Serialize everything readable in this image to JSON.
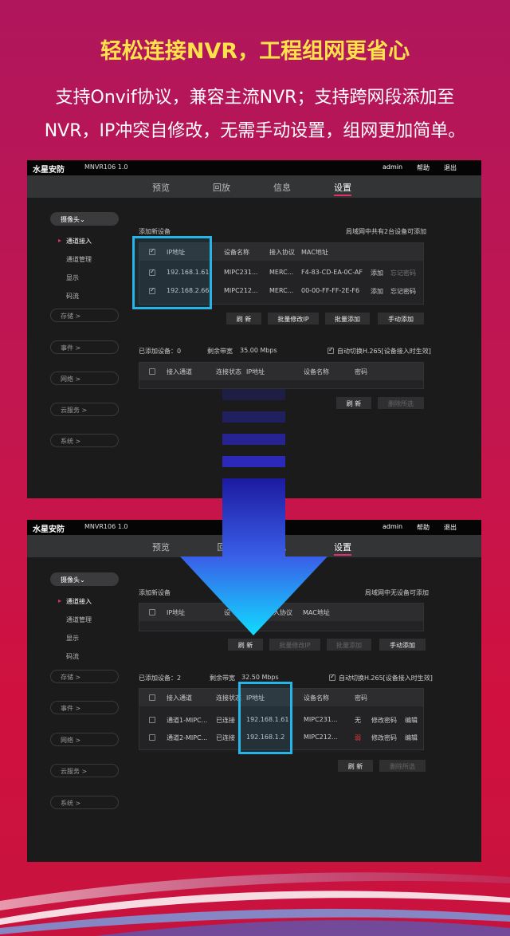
{
  "banner": {
    "headline": "轻松连接NVR，工程组网更省心",
    "line1": "支持Onvif协议，兼容主流NVR；支持跨网段添加至",
    "line2": "NVR，IP冲突自修改，无需手动设置，组网更加简单。"
  },
  "colors": {
    "accent": "#e0306a",
    "highlight": "#27b5e8",
    "headline": "#ffe24a",
    "arrow": "#0fd8ff"
  },
  "shot1": {
    "brand": "水星安防",
    "model": "MNVR106 1.0",
    "topbar": {
      "admin": "admin",
      "help": "帮助",
      "logout": "退出"
    },
    "tabs": [
      "预览",
      "回放",
      "信息",
      "设置"
    ],
    "sidebar": {
      "camera": "摄像头",
      "items": [
        "通道接入",
        "通道管理",
        "显示",
        "码流"
      ],
      "storage": "存储 >",
      "event": "事件 >",
      "network": "网络 >",
      "cloud": "云服务 >",
      "system": "系统 >"
    },
    "add_title": "添加新设备",
    "add_note": "局域网中共有2台设备可添加",
    "add_headers": [
      "IP地址",
      "设备名称",
      "接入协议",
      "MAC地址"
    ],
    "add_rows": [
      {
        "ip": "192.168.1.61",
        "name": "MIPC231...",
        "proto": "MERC...",
        "mac": "F4-83-CD-EA-0C-AF",
        "act1": "添加",
        "act2": "忘记密码"
      },
      {
        "ip": "192.168.2.66",
        "name": "MIPC212...",
        "proto": "MERC...",
        "mac": "00-00-FF-FF-2E-F6",
        "act1": "添加",
        "act2": "忘记密码"
      }
    ],
    "btns": [
      "刷 新",
      "批量修改IP",
      "批量添加",
      "手动添加"
    ],
    "added_count": "已添加设备：0",
    "bandwidth_label": "剩余带宽",
    "bandwidth": "35.00 Mbps",
    "auto_h265": "自动切换H.265[设备接入时生效]",
    "list_headers": [
      "接入通道",
      "连接状态",
      "IP地址",
      "设备名称",
      "密码"
    ],
    "list_btns": [
      "刷 新",
      "删除所选"
    ]
  },
  "shot2": {
    "brand": "水星安防",
    "model": "MNVR106 1.0",
    "topbar": {
      "admin": "admin",
      "help": "帮助",
      "logout": "退出"
    },
    "tabs": [
      "预览",
      "回放",
      "信息",
      "设置"
    ],
    "tab_partials": [
      "回",
      "息"
    ],
    "sidebar": {
      "camera": "摄像头",
      "items": [
        "通道接入",
        "通道管理",
        "显示",
        "码流"
      ],
      "storage": "存储 >",
      "event": "事件 >",
      "network": "网络 >",
      "cloud": "云服务 >",
      "system": "系统 >"
    },
    "add_title": "添加新设备",
    "add_note": "局域网中无设备可添加",
    "add_headers": [
      "IP地址",
      "设",
      "入协议",
      "MAC地址"
    ],
    "btns": [
      "刷 新",
      "批量修改IP",
      "批量添加",
      "手动添加"
    ],
    "added_count": "已添加设备：2",
    "bandwidth_label": "剩余带宽",
    "bandwidth": "32.50 Mbps",
    "auto_h265": "自动切换H.265[设备接入时生效]",
    "list_headers": [
      "接入通道",
      "连接状态",
      "IP地址",
      "设备名称",
      "密码"
    ],
    "list_rows": [
      {
        "channel": "通道1-MIPC...",
        "status": "已连接",
        "ip": "192.168.1.61",
        "name": "MIPC231...",
        "pwd": "无",
        "act1": "修改密码",
        "act2": "编辑"
      },
      {
        "channel": "通道2-MIPC...",
        "status": "已连接",
        "ip": "192.168.1.2",
        "name": "MIPC212...",
        "pwd": "弱",
        "act1": "修改密码",
        "act2": "编辑"
      }
    ],
    "list_btns": [
      "刷 新",
      "删除所选"
    ]
  }
}
